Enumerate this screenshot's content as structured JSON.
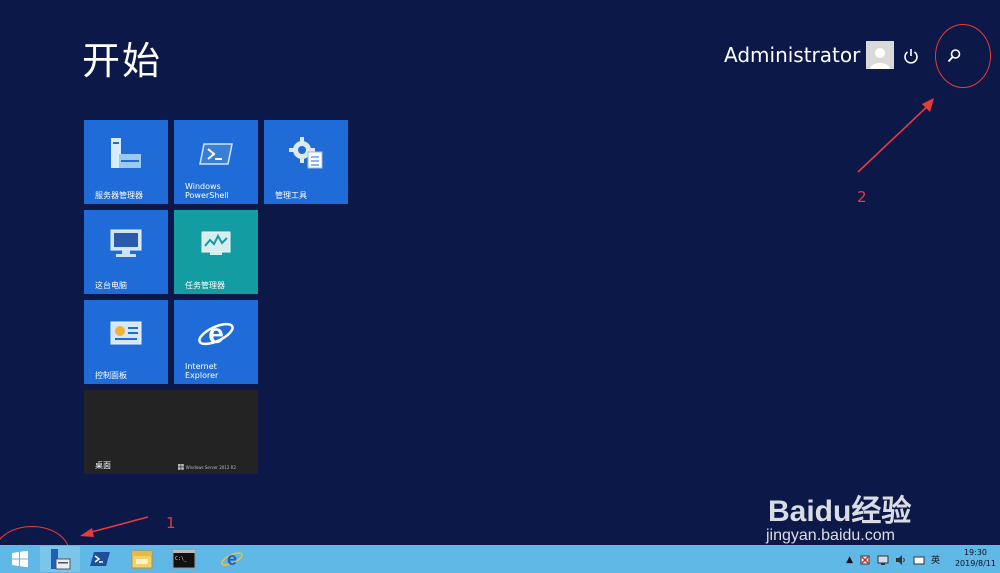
{
  "start": {
    "title": "开始"
  },
  "user": {
    "name": "Administrator"
  },
  "tiles": [
    {
      "label": "服务器管理器",
      "icon": "server-manager-icon"
    },
    {
      "label": "Windows\nPowerShell",
      "icon": "powershell-icon"
    },
    {
      "label": "管理工具",
      "icon": "admin-tools-icon"
    },
    {
      "label": "这台电脑",
      "icon": "computer-icon"
    },
    {
      "label": "任务管理器",
      "icon": "task-manager-icon"
    },
    {
      "label": "控制面板",
      "icon": "control-panel-icon"
    },
    {
      "label": "Internet\nExplorer",
      "icon": "internet-explorer-icon"
    }
  ],
  "desktop_tile": {
    "label": "桌面",
    "os_mark": "Windows Server 2012 R2"
  },
  "annotations": {
    "one": "1",
    "two": "2"
  },
  "watermark": {
    "logo": "Baidu经验",
    "url": "jingyan.baidu.com"
  },
  "taskbar": {
    "items": [
      "start-button",
      "server-manager",
      "powershell",
      "file-explorer",
      "command-prompt",
      "internet-explorer"
    ],
    "tray": {
      "ime": "英"
    },
    "clock": {
      "time": "19:30",
      "date": "2019/8/11"
    }
  },
  "colors": {
    "background": "#0c1848",
    "tile_blue": "#1f6cd8",
    "tile_teal": "#139da3",
    "taskbar": "#5fb8e6",
    "annotation": "#e83a3a"
  }
}
